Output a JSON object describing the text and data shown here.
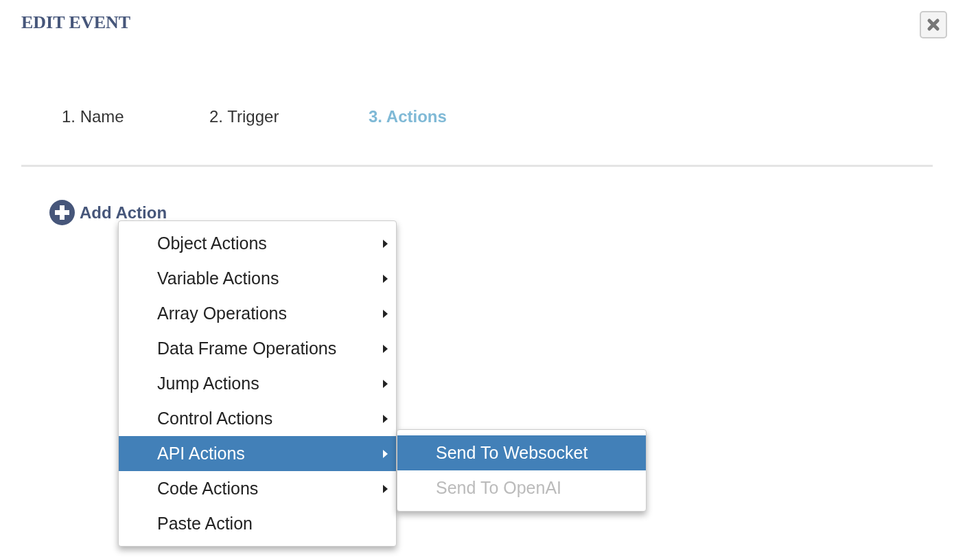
{
  "dialog": {
    "title": "EDIT EVENT"
  },
  "tabs": [
    {
      "label": "1. Name",
      "selected": false
    },
    {
      "label": "2. Trigger",
      "selected": false
    },
    {
      "label": "3. Actions",
      "selected": true
    }
  ],
  "add_action": {
    "label": "Add Action"
  },
  "menu": {
    "items": [
      {
        "label": "Object Actions",
        "has_submenu": true,
        "selected": false
      },
      {
        "label": "Variable Actions",
        "has_submenu": true,
        "selected": false
      },
      {
        "label": "Array Operations",
        "has_submenu": true,
        "selected": false
      },
      {
        "label": "Data Frame Operations",
        "has_submenu": true,
        "selected": false
      },
      {
        "label": "Jump Actions",
        "has_submenu": true,
        "selected": false
      },
      {
        "label": "Control Actions",
        "has_submenu": true,
        "selected": false
      },
      {
        "label": "API Actions",
        "has_submenu": true,
        "selected": true
      },
      {
        "label": "Code Actions",
        "has_submenu": true,
        "selected": false
      },
      {
        "label": "Paste Action",
        "has_submenu": false,
        "selected": false
      }
    ]
  },
  "submenu": {
    "items": [
      {
        "label": "Send To Websocket",
        "selected": true,
        "disabled": false
      },
      {
        "label": "Send To OpenAI",
        "selected": false,
        "disabled": true
      }
    ]
  }
}
